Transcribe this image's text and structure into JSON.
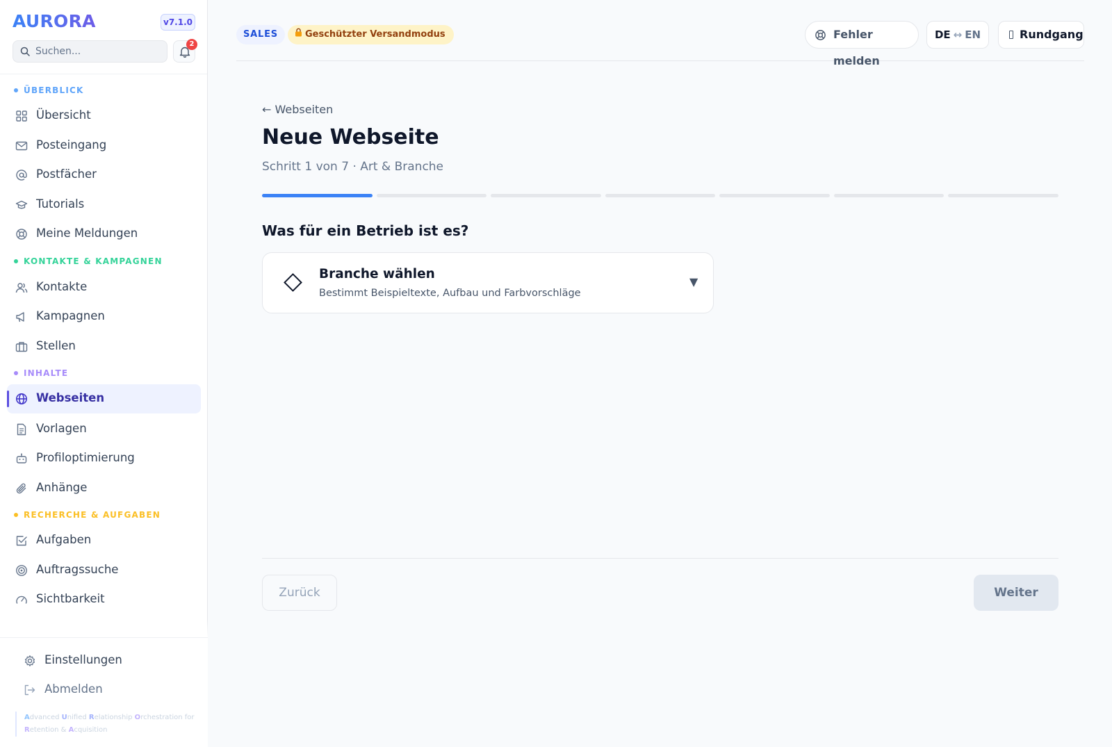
{
  "app": {
    "brand": "AURORA",
    "version": "v7.1.0"
  },
  "search": {
    "placeholder": "Suchen..."
  },
  "notifications": {
    "count": "2"
  },
  "sections": {
    "overview": "Überblick",
    "contacts": "Kontakte & Kampagnen",
    "content": "Inhalte",
    "research": "Recherche & Aufgaben"
  },
  "nav": {
    "uebersicht": "Übersicht",
    "posteingang": "Posteingang",
    "postfaecher": "Postfächer",
    "tutorials": "Tutorials",
    "meldungen": "Meine Meldungen",
    "kontakte": "Kontakte",
    "kampagnen": "Kampagnen",
    "stellen": "Stellen",
    "webseiten": "Webseiten",
    "vorlagen": "Vorlagen",
    "profiloptimierung": "Profiloptimierung",
    "anhaenge": "Anhänge",
    "aufgaben": "Aufgaben",
    "auftragssuche": "Auftragssuche",
    "sichtbarkeit": "Sichtbarkeit",
    "einstellungen": "Einstellungen",
    "abmelden": "Abmelden"
  },
  "colors": {
    "overview": "#60a5fa",
    "contacts": "#34d399",
    "content": "#a78bfa",
    "research": "#fbbf24",
    "accent": "#3b82f6"
  },
  "tagline": {
    "parts": [
      {
        "cap": "A",
        "rest": "dvanced "
      },
      {
        "cap": "U",
        "rest": "nified "
      },
      {
        "cap": "R",
        "rest": "elationship "
      },
      {
        "cap": "O",
        "rest": "rchestration for "
      },
      {
        "cap": "R",
        "rest": "etention & "
      },
      {
        "cap": "A",
        "rest": "cquisition"
      }
    ]
  },
  "topbar": {
    "sales": "SALES",
    "mode": "Geschützter Versandmodus",
    "bug": "Fehler melden",
    "lang_de": "DE",
    "lang_arrow": "↔",
    "lang_en": "EN",
    "tour": "Rundgang"
  },
  "wizard": {
    "back_link": "← Webseiten",
    "title": "Neue Webseite",
    "step_info": "Schritt 1 von 7 · Art & Branche",
    "step_current": 1,
    "step_total": 7,
    "question": "Was für ein Betrieb ist es?",
    "select_title": "Branche wählen",
    "select_sub": "Bestimmt Beispieltexte, Aufbau und Farbvorschläge",
    "btn_back": "Zurück",
    "btn_next": "Weiter"
  }
}
